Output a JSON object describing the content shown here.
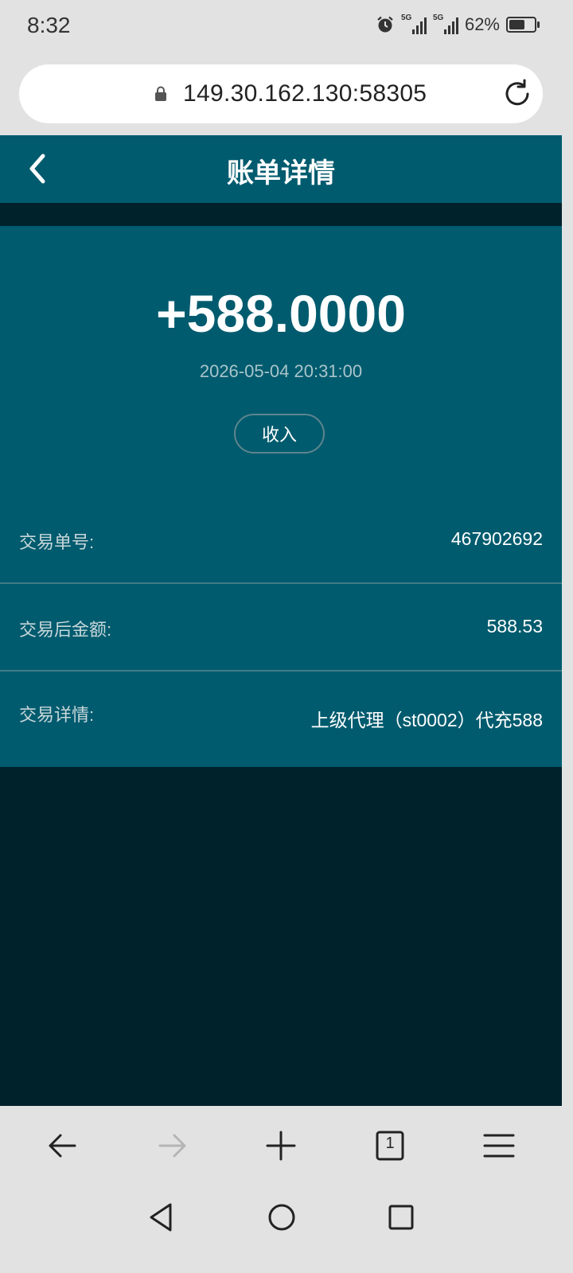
{
  "status_bar": {
    "time": "8:32",
    "network_1": "5G",
    "network_2": "5G",
    "battery_percent": "62%",
    "battery_level": 0.62
  },
  "browser": {
    "url": "149.30.162.130:58305"
  },
  "header": {
    "title": "账单详情"
  },
  "transaction": {
    "amount": "+588.0000",
    "datetime": "2026-05-04 20:31:00",
    "type": "收入",
    "fields": [
      {
        "label": "交易单号:",
        "value": "467902692"
      },
      {
        "label": "交易后金额:",
        "value": "588.53"
      },
      {
        "label": "交易详情:",
        "value": "上级代理（st0002）代充588"
      }
    ]
  },
  "tab_count": "1",
  "colors": {
    "header_bg": "#005b6e",
    "page_dark": "#00222b",
    "chrome_bg": "#e2e2e2",
    "disabled_icon": "#b5b5b5"
  },
  "icons": {
    "status": [
      "alarm-icon",
      "signal-icon",
      "battery-icon"
    ],
    "browser": [
      "lock-icon",
      "reload-icon"
    ],
    "header": [
      "back-chevron-icon"
    ],
    "browser_nav": [
      "back-arrow-icon",
      "forward-arrow-icon",
      "plus-icon",
      "tabs-icon",
      "menu-icon"
    ],
    "system_nav": [
      "triangle-back-icon",
      "circle-home-icon",
      "square-recents-icon"
    ]
  }
}
